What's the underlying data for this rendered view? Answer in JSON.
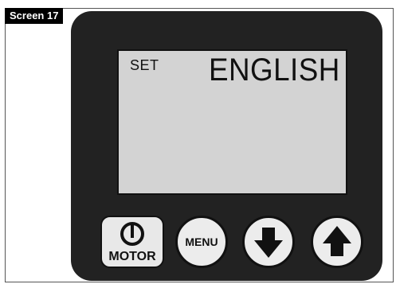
{
  "figure_tag": "Screen 17",
  "display": {
    "set_label": "SET",
    "language_value": "ENGLISH"
  },
  "buttons": {
    "motor_label": "MOTOR",
    "menu_label": "MENU",
    "down_icon": "down-arrow",
    "up_icon": "up-arrow",
    "power_icon": "power-symbol"
  },
  "colors": {
    "device_body": "#222222",
    "lcd_background": "#d3d3d3",
    "button_face": "#ececec"
  }
}
